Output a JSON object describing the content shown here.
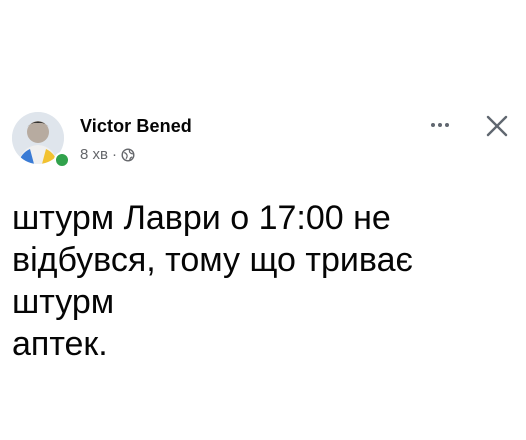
{
  "post": {
    "author": "Victor Bened",
    "time": "8 хв",
    "separator": "·",
    "text": "штурм Лаври о 17:00 не\nвідбувся, тому що триває штурм\nаптек."
  },
  "icons": {
    "more": "more-options-icon",
    "close": "close-icon",
    "audience": "globe-icon",
    "online": "online-status-icon"
  },
  "colors": {
    "online": "#31a24c",
    "text": "#050505",
    "meta": "#65676b"
  }
}
